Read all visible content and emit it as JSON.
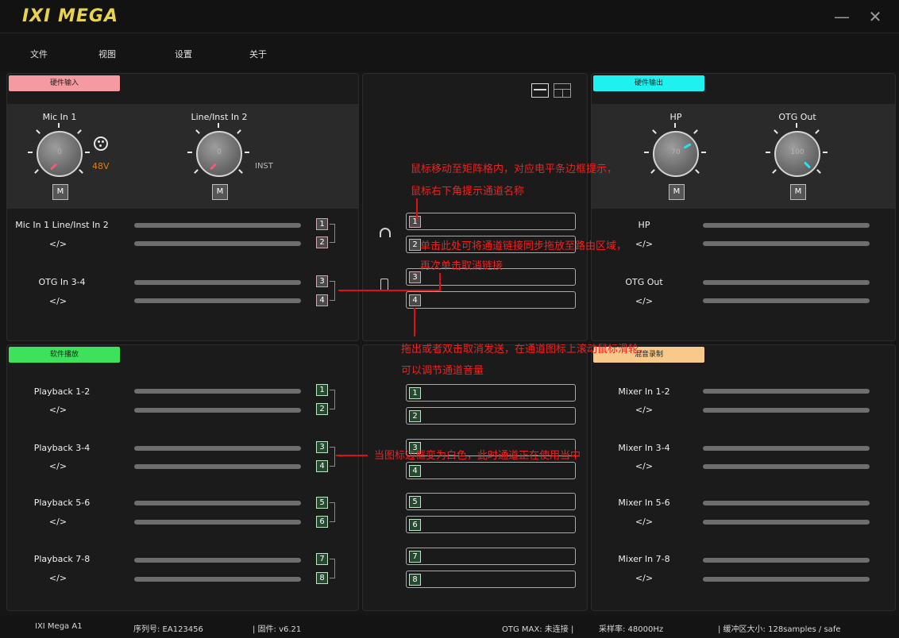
{
  "app": {
    "logo": "IXI MEGA",
    "minimize": "—",
    "close": "✕"
  },
  "menu": [
    "文件",
    "视图",
    "设置",
    "关于"
  ],
  "hw_input": {
    "tag": "硬件输入",
    "tag_color": "#f49aa0",
    "knobs": [
      {
        "label": "Mic In 1",
        "value": "0",
        "extra": "48V"
      },
      {
        "label": "Line/Inst In 2",
        "value": "0",
        "extra": "INST"
      }
    ],
    "mute": "M",
    "channels": [
      {
        "label": "Mic In 1  Line/Inst In 2",
        "code": "</>",
        "nums": [
          "1",
          "2"
        ]
      },
      {
        "label": "OTG In 3-4",
        "code": "</>",
        "nums": [
          "3",
          "4"
        ]
      }
    ]
  },
  "hw_output": {
    "tag": "硬件输出",
    "tag_color": "#1ff0f0",
    "knobs": [
      {
        "label": "HP",
        "value": "70"
      },
      {
        "label": "OTG Out",
        "value": "100"
      }
    ],
    "mute": "M",
    "channels": [
      {
        "label": "HP",
        "code": "</>"
      },
      {
        "label": "OTG Out",
        "code": "</>"
      }
    ]
  },
  "sw_play": {
    "tag": "软件播放",
    "tag_color": "#3ee05c",
    "channels": [
      {
        "label": "Playback 1-2",
        "code": "</>",
        "nums": [
          "1",
          "2"
        ]
      },
      {
        "label": "Playback 3-4",
        "code": "</>",
        "nums": [
          "3",
          "4"
        ]
      },
      {
        "label": "Playback 5-6",
        "code": "</>",
        "nums": [
          "5",
          "6"
        ]
      },
      {
        "label": "Playback 7-8",
        "code": "</>",
        "nums": [
          "7",
          "8"
        ]
      }
    ]
  },
  "mix_rec": {
    "tag": "混音录制",
    "tag_color": "#f7c98a",
    "channels": [
      {
        "label": "Mixer In 1-2",
        "code": "</>"
      },
      {
        "label": "Mixer In 3-4",
        "code": "</>"
      },
      {
        "label": "Mixer In 5-6",
        "code": "</>"
      },
      {
        "label": "Mixer In 7-8",
        "code": "</>"
      }
    ]
  },
  "matrix_top": [
    "1",
    "2",
    "3",
    "4"
  ],
  "matrix_bottom": [
    "1",
    "2",
    "3",
    "4",
    "5",
    "6",
    "7",
    "8"
  ],
  "annotations": [
    "鼠标移动至矩阵格内，对应电平条边框提示，",
    "鼠标右下角提示通道名称",
    "单击此处可将通道链接同步拖放至路由区域，",
    "再次单击取消链接",
    "拖出或者双击取消发送，在通道图标上滚动鼠标滑轮，",
    "可以调节通道音量",
    "当图标边框变为白色，此时通道正在使用当中"
  ],
  "status": {
    "device": "IXI Mega A1",
    "serial": "序列号: EA123456",
    "firmware": "| 固件: v6.21",
    "otg": "OTG MAX: 未连接 |",
    "rate": "采样率: 48000Hz",
    "buffer": "| 缓冲区大小: 128samples / safe"
  }
}
